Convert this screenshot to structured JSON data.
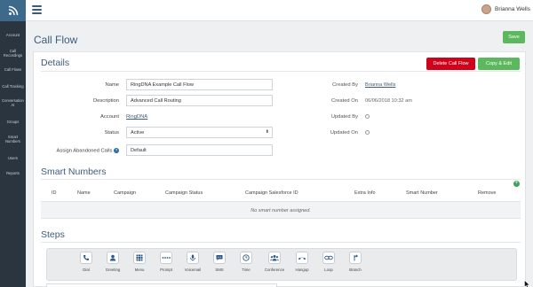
{
  "sidebar": {
    "items": [
      {
        "label": "Account"
      },
      {
        "label": "Call Recordings"
      },
      {
        "label": "Call Flows"
      },
      {
        "label": "Call Tracking"
      },
      {
        "label": "Conversation AI"
      },
      {
        "label": "Groups"
      },
      {
        "label": "Smart Numbers"
      },
      {
        "label": "Users"
      },
      {
        "label": "Reports"
      }
    ]
  },
  "topbar": {
    "user_name": "Brianna Wells"
  },
  "page": {
    "title": "Call Flow",
    "save_label": "Save"
  },
  "details": {
    "title": "Details",
    "delete_label": "Delete Call Flow",
    "copy_label": "Copy & Edit",
    "fields": {
      "name_label": "Name",
      "name_value": "RingDNA Example Call Flow",
      "description_label": "Description",
      "description_value": "Advanced Call Routing",
      "account_label": "Account",
      "account_value": "RingDNA",
      "status_label": "Status",
      "status_value": "Active",
      "abandoned_label": "Assign Abandoned Calls",
      "abandoned_value": "Default"
    },
    "meta": {
      "created_by_label": "Created By",
      "created_by_value": "Brianna Wells",
      "created_on_label": "Created On",
      "created_on_value": "06/06/2018 10:32 am",
      "updated_by_label": "Updated By",
      "updated_on_label": "Updated On"
    }
  },
  "smart_numbers": {
    "title": "Smart Numbers",
    "columns": [
      "ID",
      "Name",
      "Campaign",
      "Campaign Status",
      "Campaign Salesforce ID",
      "Extra Info",
      "Smart Number",
      "Remove"
    ],
    "empty_text": "No smart number assigned."
  },
  "steps": {
    "title": "Steps",
    "items": [
      {
        "label": "Dial",
        "icon": "phone-icon"
      },
      {
        "label": "Greeting",
        "icon": "person-icon"
      },
      {
        "label": "Menu",
        "icon": "grid-icon"
      },
      {
        "label": "Prompt",
        "icon": "dots-icon"
      },
      {
        "label": "Voicemail",
        "icon": "microphone-icon"
      },
      {
        "label": "SMS",
        "icon": "chat-icon"
      },
      {
        "label": "Time",
        "icon": "clock-icon"
      },
      {
        "label": "Conference",
        "icon": "group-icon"
      },
      {
        "label": "Hangup",
        "icon": "hangup-icon"
      },
      {
        "label": "Loop",
        "icon": "loop-icon"
      },
      {
        "label": "Branch",
        "icon": "branch-icon"
      }
    ]
  },
  "colors": {
    "accent": "#3c5c7b",
    "save": "#5cb85c",
    "delete": "#d0021b",
    "sidebar": "#2b3540"
  }
}
